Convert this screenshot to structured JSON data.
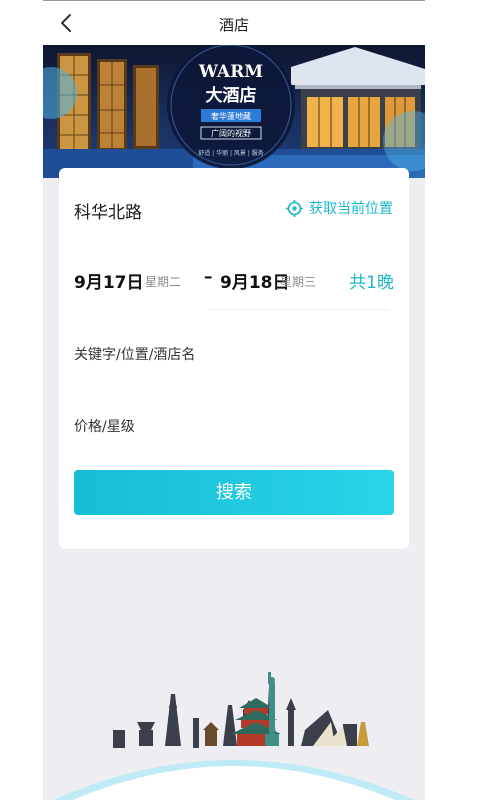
{
  "header": {
    "title": "酒店",
    "back_icon": "chevron-left-icon"
  },
  "banner": {
    "brand": "WARM",
    "name": "大酒店",
    "tag1": "奢华蓬地藏",
    "tag2": "广阔的视野",
    "features": "舒适 | 华丽 | 风景 | 服务"
  },
  "search": {
    "location": "科华北路",
    "locate_label": "获取当前位置",
    "checkin_date": "9月17日",
    "checkin_weekday": "星期二",
    "checkout_date": "9月18日",
    "checkout_weekday": "星期三",
    "separator": "–",
    "nights": "共1晚",
    "keyword_placeholder": "关键字/位置/酒店名",
    "price_label": "价格/星级",
    "search_button": "搜索"
  },
  "colors": {
    "accent": "#1cb7c9",
    "button_start": "#17bdd4",
    "button_end": "#2ad5e8",
    "background": "#eeeef2"
  }
}
